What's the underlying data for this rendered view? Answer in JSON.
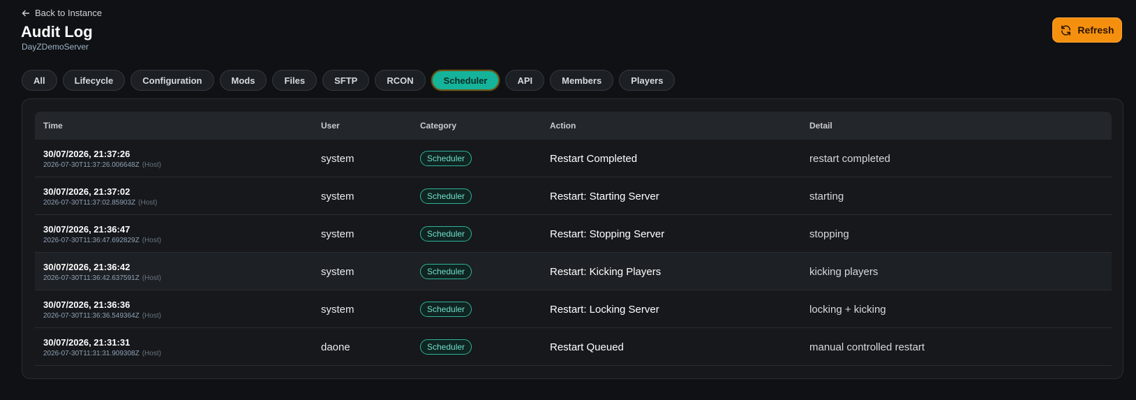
{
  "nav": {
    "back_label": "Back to Instance"
  },
  "header": {
    "title": "Audit Log",
    "subtitle": "DayZDemoServer",
    "refresh_label": "Refresh"
  },
  "filters": {
    "items": [
      "All",
      "Lifecycle",
      "Configuration",
      "Mods",
      "Files",
      "SFTP",
      "RCON",
      "Scheduler",
      "API",
      "Members",
      "Players"
    ],
    "active": "Scheduler"
  },
  "table": {
    "columns": [
      "Time",
      "User",
      "Category",
      "Action",
      "Detail"
    ],
    "rows": [
      {
        "time": "30/07/2026, 21:37:26",
        "iso": "2026-07-30T11:37:26.006648Z",
        "host": "(Host)",
        "user": "system",
        "category": "Scheduler",
        "action": "Restart Completed",
        "detail": "restart completed"
      },
      {
        "time": "30/07/2026, 21:37:02",
        "iso": "2026-07-30T11:37:02.85903Z",
        "host": "(Host)",
        "user": "system",
        "category": "Scheduler",
        "action": "Restart: Starting Server",
        "detail": "starting"
      },
      {
        "time": "30/07/2026, 21:36:47",
        "iso": "2026-07-30T11:36:47.692829Z",
        "host": "(Host)",
        "user": "system",
        "category": "Scheduler",
        "action": "Restart: Stopping Server",
        "detail": "stopping"
      },
      {
        "time": "30/07/2026, 21:36:42",
        "iso": "2026-07-30T11:36:42.637591Z",
        "host": "(Host)",
        "user": "system",
        "category": "Scheduler",
        "action": "Restart: Kicking Players",
        "detail": "kicking players"
      },
      {
        "time": "30/07/2026, 21:36:36",
        "iso": "2026-07-30T11:36:36.549364Z",
        "host": "(Host)",
        "user": "system",
        "category": "Scheduler",
        "action": "Restart: Locking Server",
        "detail": "locking + kicking"
      },
      {
        "time": "30/07/2026, 21:31:31",
        "iso": "2026-07-30T11:31:31.909308Z",
        "host": "(Host)",
        "user": "daone",
        "category": "Scheduler",
        "action": "Restart Queued",
        "detail": "manual controlled restart"
      }
    ]
  },
  "colors": {
    "accent": "#15b39a",
    "refresh": "#f5900e",
    "background": "#0f1114"
  }
}
